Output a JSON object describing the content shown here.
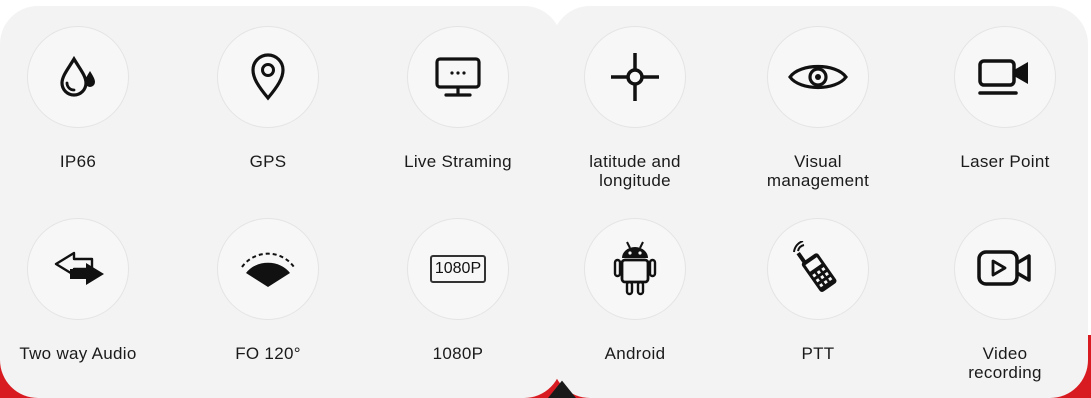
{
  "colors": {
    "panel": "#f3f3f3",
    "accent_band": "#d81b20",
    "icon": "#111111"
  },
  "features": [
    {
      "label": "IP66",
      "icon": "water-drops-icon"
    },
    {
      "label": "GPS",
      "icon": "location-pin-icon"
    },
    {
      "label": "Live Straming",
      "icon": "monitor-icon"
    },
    {
      "label": "latitude and longitude",
      "icon": "crosshair-icon"
    },
    {
      "label": "Visual management",
      "icon": "eye-icon"
    },
    {
      "label": "Laser Point",
      "icon": "camera-icon"
    },
    {
      "label": "Two way Audio",
      "icon": "two-way-arrows-icon"
    },
    {
      "label": "FO 120°",
      "icon": "wide-angle-icon"
    },
    {
      "label": "1080P",
      "icon": "resolution-1080p-icon",
      "badge": "1080P"
    },
    {
      "label": "Android",
      "icon": "android-icon"
    },
    {
      "label": "PTT",
      "icon": "walkie-talkie-icon"
    },
    {
      "label": "Video recording",
      "icon": "video-recording-icon"
    }
  ]
}
